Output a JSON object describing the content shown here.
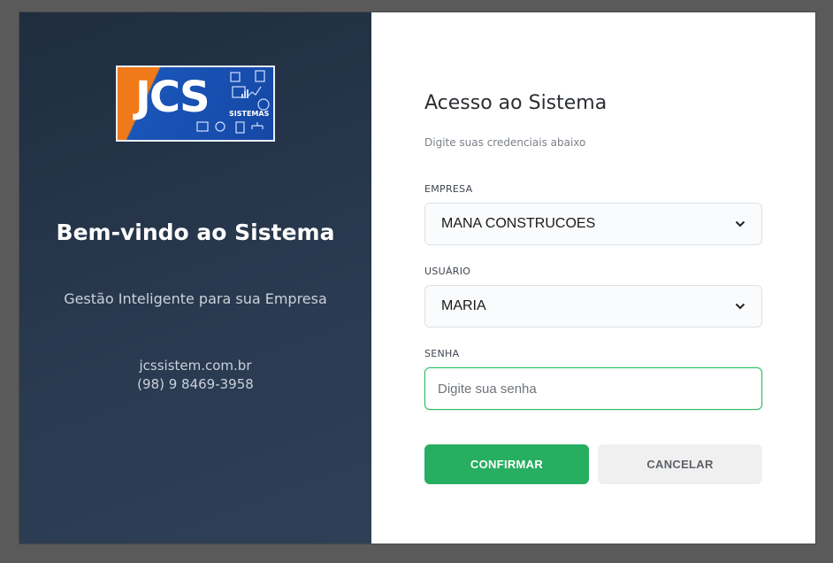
{
  "brand": {
    "logo_text": "JCS",
    "logo_sub": "SISTEMAS",
    "colors": {
      "orange": "#f07a1a",
      "blue": "#1548a6"
    }
  },
  "left_panel": {
    "welcome": "Bem-vindo ao Sistema",
    "tagline": "Gestão Inteligente para sua Empresa",
    "website": "jcssistem.com.br",
    "phone": "(98) 9 8469-3958"
  },
  "form": {
    "title": "Acesso ao Sistema",
    "subtitle": "Digite suas credenciais abaixo",
    "empresa": {
      "label": "EMPRESA",
      "value": "MANA CONSTRUCOES"
    },
    "usuario": {
      "label": "USUÁRIO",
      "value": "MARIA"
    },
    "senha": {
      "label": "SENHA",
      "placeholder": "Digite sua senha"
    },
    "confirm_label": "CONFIRMAR",
    "cancel_label": "CANCELAR"
  },
  "theme": {
    "accent": "#27ae60",
    "panel_dark": "#1f2d3f"
  }
}
